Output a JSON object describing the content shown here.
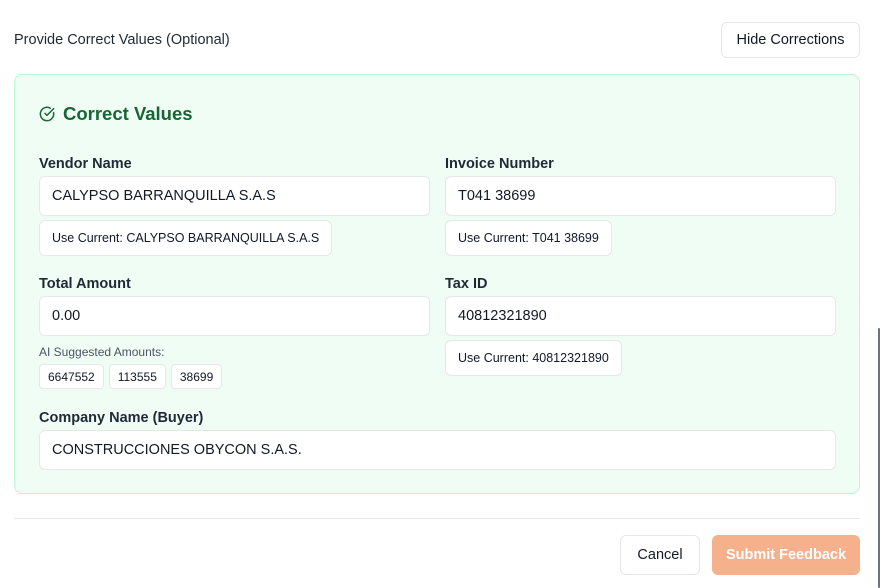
{
  "header": {
    "title": "Provide Correct Values (Optional)",
    "hide_button": "Hide Corrections"
  },
  "panel": {
    "title": "Correct Values",
    "icon": "check-circle-icon",
    "colors": {
      "background": "#f0fdf4",
      "border": "#bbf7d0",
      "title": "#166534"
    }
  },
  "fields": {
    "vendor_name": {
      "label": "Vendor Name",
      "value": "CALYPSO BARRANQUILLA S.A.S",
      "use_current": "Use Current: CALYPSO BARRANQUILLA S.A.S"
    },
    "invoice_number": {
      "label": "Invoice Number",
      "value": "T041 38699",
      "use_current": "Use Current: T041 38699"
    },
    "total_amount": {
      "label": "Total Amount",
      "value": "0.00",
      "ai_label": "AI Suggested Amounts:",
      "suggestions": [
        "6647552",
        "113555",
        "38699"
      ]
    },
    "tax_id": {
      "label": "Tax ID",
      "value": "40812321890",
      "use_current": "Use Current: 40812321890"
    },
    "company_name": {
      "label": "Company Name (Buyer)",
      "value": "CONSTRUCCIONES OBYCON S.A.S."
    }
  },
  "footer": {
    "cancel": "Cancel",
    "submit": "Submit Feedback",
    "submit_color": "#f5b08c",
    "submit_disabled": true
  }
}
